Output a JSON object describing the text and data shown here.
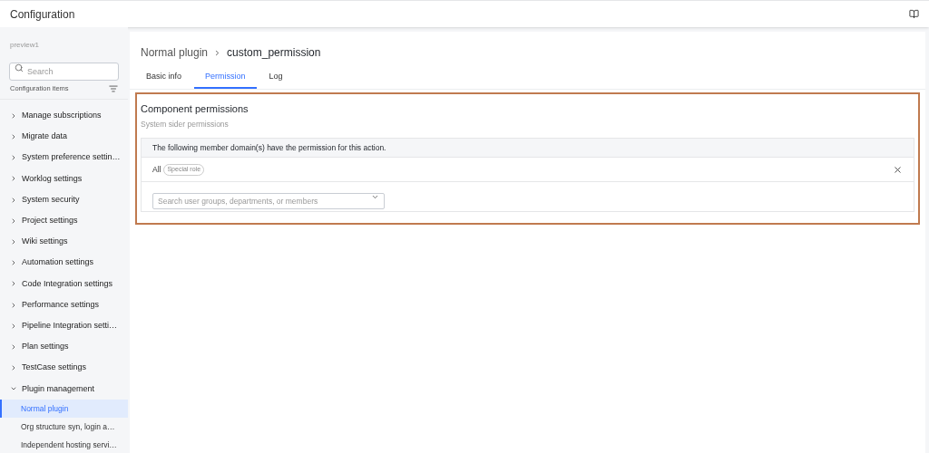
{
  "header": {
    "title": "Configuration"
  },
  "sidebar": {
    "project": "preview1",
    "search": {
      "placeholder": "Search"
    },
    "section_label": "Configuration items",
    "items": [
      {
        "label": "Manage subscriptions",
        "expanded": false
      },
      {
        "label": "Migrate data",
        "expanded": false
      },
      {
        "label": "System preference settin…",
        "expanded": false
      },
      {
        "label": "Worklog settings",
        "expanded": false
      },
      {
        "label": "System security",
        "expanded": false
      },
      {
        "label": "Project settings",
        "expanded": false
      },
      {
        "label": "Wiki settings",
        "expanded": false
      },
      {
        "label": "Automation settings",
        "expanded": false
      },
      {
        "label": "Code Integration settings",
        "expanded": false
      },
      {
        "label": "Performance settings",
        "expanded": false
      },
      {
        "label": "Pipeline Integration setti…",
        "expanded": false
      },
      {
        "label": "Plan settings",
        "expanded": false
      },
      {
        "label": "TestCase settings",
        "expanded": false
      },
      {
        "label": "Plugin management",
        "expanded": true,
        "children": [
          {
            "label": "Normal plugin",
            "selected": true
          },
          {
            "label": "Org structure syn, login a…",
            "selected": false
          },
          {
            "label": "Independent hosting servi…",
            "selected": false
          }
        ]
      }
    ]
  },
  "breadcrumb": [
    "Normal plugin",
    "custom_permission"
  ],
  "tabs": [
    {
      "label": "Basic info",
      "selected": false
    },
    {
      "label": "Permission",
      "selected": true
    },
    {
      "label": "Log",
      "selected": false
    }
  ],
  "section": {
    "title": "Component permissions",
    "subtitle": "System sider permissions",
    "notice": "The following member domain(s) have the permission for this action.",
    "members": [
      {
        "name": "All",
        "tag": "Special role"
      }
    ],
    "picker": {
      "placeholder": "Search user groups, departments, or members"
    }
  }
}
